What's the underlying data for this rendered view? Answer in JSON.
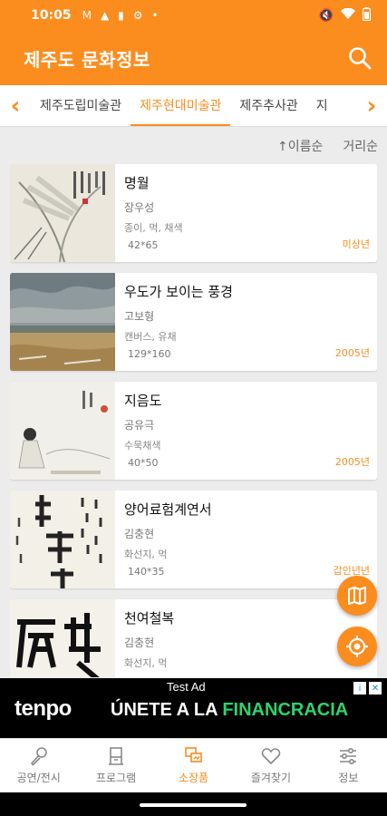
{
  "status_bar": {
    "time": "10:05",
    "left_icons": [
      "gmail-icon",
      "person-icon",
      "clipboard-icon",
      "gear-icon",
      "dot-icon"
    ],
    "right_icons": [
      "mute-icon",
      "wifi-icon",
      "battery-icon"
    ]
  },
  "app_bar": {
    "title": "제주도 문화정보",
    "search_icon": "search-icon"
  },
  "tabs": {
    "items": [
      {
        "label": "제주도립미술관",
        "active": false
      },
      {
        "label": "제주현대미술관",
        "active": true
      },
      {
        "label": "제주추사관",
        "active": false
      },
      {
        "label": "지",
        "active": false
      }
    ]
  },
  "sort": {
    "by_name": "↑이름순",
    "by_distance": "거리순"
  },
  "artworks": [
    {
      "name": "명월",
      "artist": "장우성",
      "material": "종이, 먹, 채색",
      "size": "42*65",
      "year": "미상년"
    },
    {
      "name": "우도가 보이는 풍경",
      "artist": "고보형",
      "material": "캔버스, 유채",
      "size": "129*160",
      "year": "2005년"
    },
    {
      "name": "지음도",
      "artist": "공유극",
      "material": "수묵채색",
      "size": "40*50",
      "year": "2005년"
    },
    {
      "name": "양어료험계연서",
      "artist": "김충현",
      "material": "화선지, 먹",
      "size": "140*35",
      "year": "갑인년년"
    },
    {
      "name": "천여철복",
      "artist": "김충현",
      "material": "화선지, 먹",
      "size": "",
      "year": ""
    }
  ],
  "ad": {
    "label": "Test Ad",
    "brand": "tenpo",
    "headline_prefix": "ÚNETE A LA ",
    "headline_highlight": "FINANCRACIA",
    "colors": {
      "highlight": "#2ed46b",
      "background": "#000000"
    }
  },
  "bottom_nav": [
    {
      "label": "공연/전시",
      "icon": "microphone-icon",
      "active": false
    },
    {
      "label": "프로그램",
      "icon": "program-icon",
      "active": false
    },
    {
      "label": "소장품",
      "icon": "collection-icon",
      "active": true
    },
    {
      "label": "즐겨찾기",
      "icon": "heart-icon",
      "active": false
    },
    {
      "label": "정보",
      "icon": "sliders-icon",
      "active": false
    }
  ],
  "colors": {
    "accent": "#fb8c1e",
    "background": "#ececec"
  }
}
